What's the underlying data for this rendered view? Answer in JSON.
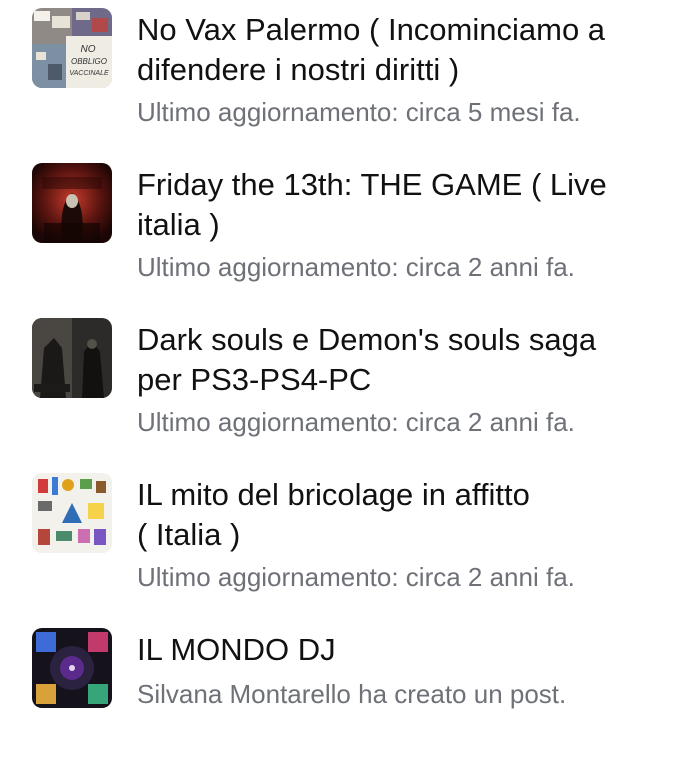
{
  "groups": [
    {
      "name_line1": "No Vax Palermo ( Incominciamo a",
      "name_line2": "difendere i nostri diritti  )",
      "meta": "Ultimo aggiornamento: circa 5 mesi fa.",
      "thumb_text_1": "NO",
      "thumb_text_2": "OBBLIGO",
      "thumb_text_3": "VACCINALE"
    },
    {
      "name_line1": "Friday the 13th: THE GAME ( Live",
      "name_line2": "italia  )",
      "meta": "Ultimo aggiornamento: circa 2 anni fa."
    },
    {
      "name_line1": "Dark souls e Demon's souls saga",
      "name_line2": "per PS3-PS4-PC",
      "meta": "Ultimo aggiornamento: circa 2 anni fa."
    },
    {
      "name_line1": "IL mito del bricolage in affitto",
      "name_line2": "( Italia )",
      "meta": "Ultimo aggiornamento: circa 2 anni fa."
    },
    {
      "name_line1": "IL MONDO DJ",
      "name_line2": "",
      "meta": "Silvana Montarello ha creato un post."
    }
  ]
}
